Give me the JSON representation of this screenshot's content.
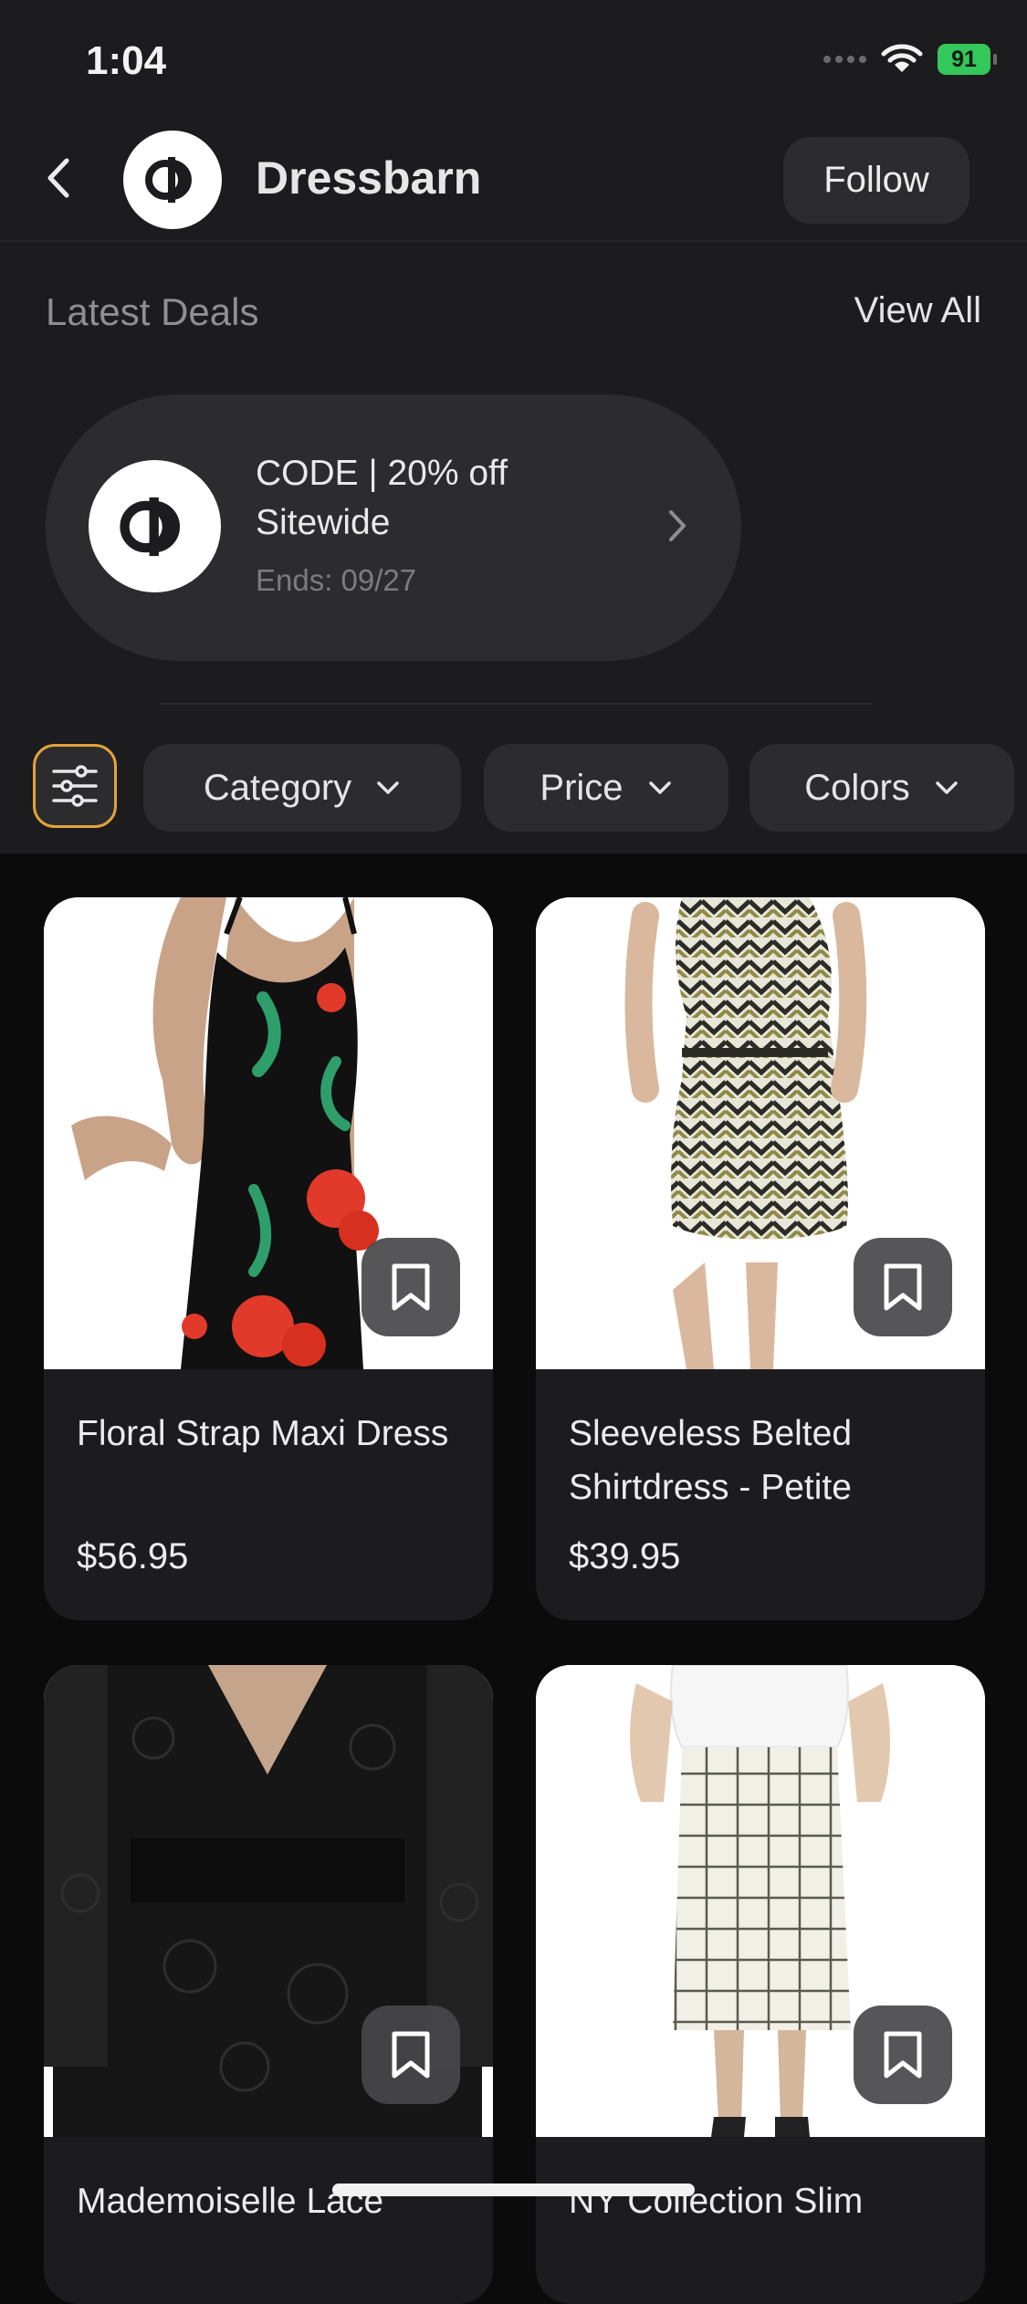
{
  "status": {
    "time": "1:04",
    "battery": "91"
  },
  "header": {
    "store_name": "Dressbarn",
    "follow_label": "Follow"
  },
  "deals": {
    "title": "Latest Deals",
    "view_all": "View All",
    "card": {
      "title": "CODE | 20% off Sitewide",
      "ends": "Ends: 09/27"
    }
  },
  "filters": {
    "chips": [
      "Category",
      "Price",
      "Colors"
    ]
  },
  "products": [
    {
      "name": "Floral Strap Maxi Dress",
      "price": "$56.95"
    },
    {
      "name": "Sleeveless Belted Shirtdress - Petite",
      "price": "$39.95"
    },
    {
      "name": "Mademoiselle Lace",
      "price": ""
    },
    {
      "name": "NY Collection Slim",
      "price": ""
    }
  ],
  "colors": {
    "accent": "#e3a33a",
    "surface": "#1c1c1e",
    "chip": "#2c2c2e",
    "battery": "#34c759"
  }
}
